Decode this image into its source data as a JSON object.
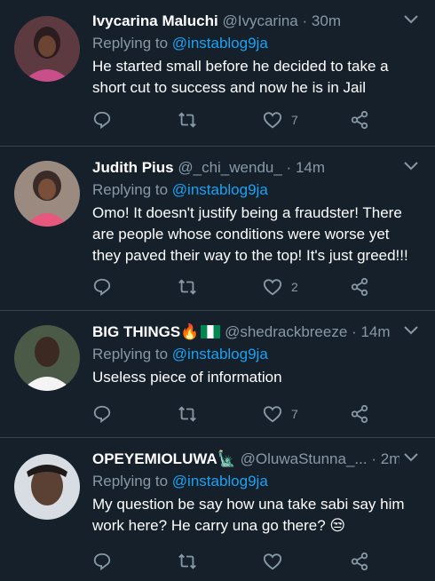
{
  "tweets": [
    {
      "name": "Ivycarina Maluchi",
      "handle": "@Ivycarina",
      "time": "30m",
      "reply_prefix": "Replying to ",
      "reply_to": "@instablog9ja",
      "text": "He started small before he decided to take a short cut to success and now he is in Jail",
      "likes": "7",
      "avatar_colors": [
        "#c94f8a",
        "#2b1c20"
      ]
    },
    {
      "name": "Judith Pius",
      "handle": "@_chi_wendu_",
      "time": "14m",
      "reply_prefix": "Replying to ",
      "reply_to": "@instablog9ja",
      "text": "Omo! It doesn't justify being a fraudster! There are people whose conditions were worse yet they paved their way to the top! It's just greed!!!",
      "likes": "2",
      "avatar_colors": [
        "#e8577e",
        "#3a2a28"
      ]
    },
    {
      "name": "BIG THINGS",
      "name_emoji": "🔥",
      "handle": "@shedrackbreeze",
      "time": "14m",
      "reply_prefix": "Replying to ",
      "reply_to": "@instablog9ja",
      "text": "Useless piece of information",
      "likes": "7",
      "avatar_colors": [
        "#f4f4f4",
        "#3c2a22"
      ]
    },
    {
      "name": "OPEYEMIOLUWA",
      "name_emoji": "🗽",
      "handle": "@OluwaStunna_...",
      "time": "2m",
      "reply_prefix": "Replying to ",
      "reply_to": "@instablog9ja",
      "text": "My question be say how una take sabi say him work here? He carry una go there? 😒",
      "likes": "",
      "avatar_colors": [
        "#d8dde3",
        "#5b4034"
      ]
    }
  ],
  "icons": {
    "reply": "reply-icon",
    "retweet": "retweet-icon",
    "like": "heart-icon",
    "share": "share-icon",
    "menu": "chevron-down-icon"
  },
  "colors": {
    "background": "#15202b",
    "divider": "#38444d",
    "secondary_text": "#8899a6",
    "accent": "#1da1f2"
  }
}
